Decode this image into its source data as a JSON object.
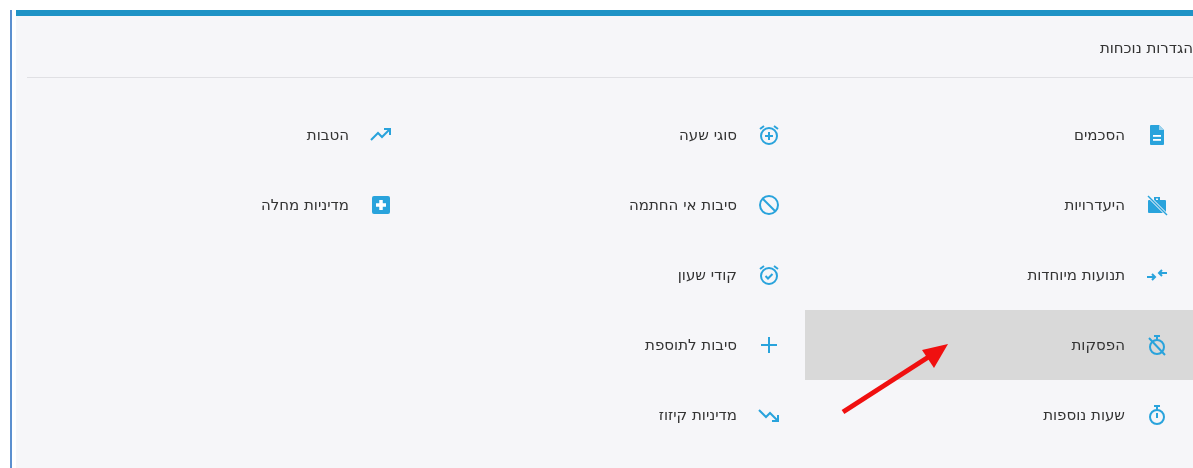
{
  "panel": {
    "title": "הגדרות נוכחות"
  },
  "columns": [
    {
      "items": [
        {
          "label": "הסכמים",
          "selected": false
        },
        {
          "label": "היעדרויות",
          "selected": false
        },
        {
          "label": "תנועות מיוחדות",
          "selected": false
        },
        {
          "label": "הפסקות",
          "selected": true
        },
        {
          "label": "שעות נוספות",
          "selected": false
        }
      ]
    },
    {
      "items": [
        {
          "label": "סוגי שעה",
          "selected": false
        },
        {
          "label": "סיבות אי החתמה",
          "selected": false
        },
        {
          "label": "קודי שעון",
          "selected": false
        },
        {
          "label": "סיבות לתוספת",
          "selected": false
        },
        {
          "label": "מדיניות קיזוז",
          "selected": false
        }
      ]
    },
    {
      "items": [
        {
          "label": "הטבות",
          "selected": false
        },
        {
          "label": "מדיניות מחלה",
          "selected": false
        }
      ]
    }
  ],
  "pointer_arrow": true
}
